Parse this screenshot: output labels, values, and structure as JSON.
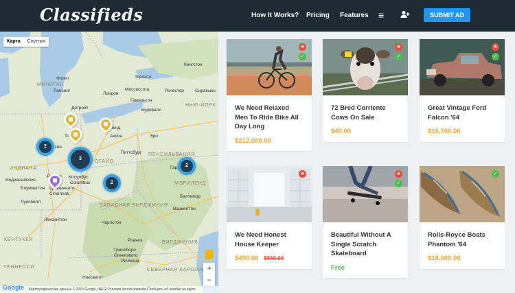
{
  "header": {
    "logo": "Classifieds",
    "nav": [
      "How It Works?",
      "Pricing",
      "Features"
    ],
    "menu_icon": "hamburger-icon",
    "user_icon": "add-user-icon",
    "submit_label": "SUBMIT AD",
    "colors": {
      "bar": "#1e2b33",
      "accent": "#2196f3"
    }
  },
  "map": {
    "type_tabs": [
      "Карта",
      "Спутник"
    ],
    "active_tab": "Карта",
    "regions": [
      "МИЧИГАН",
      "ИНДИАНА",
      "ОГАЙО",
      "ПЕНСИЛЬВАНИЯ",
      "ЗАПАДНАЯ ВИРДЖИНИЯ",
      "ВИРДЖИНИЯ",
      "МЭРИЛЕНД",
      "НЬЮ-ЙОРК",
      "СЕВЕРНАЯ КАРОЛИНА",
      "ТЕННЕССИ",
      "КЕНТУККИ"
    ],
    "cities": [
      "Торонто",
      "Детройт",
      "Толедо",
      "Кливленд",
      "Columbus",
      "Колумбус",
      "Питтсбург",
      "Цинциннати",
      "Cincinnati",
      "Индианаполис",
      "Лексингтон",
      "Ричмонд",
      "Буффало",
      "Рочестер",
      "Вашингтон",
      "Балтимор",
      "Гаррисберг",
      "Эри",
      "Дейтон",
      "Луисвилл",
      "Блумингтон",
      "Кингстон",
      "Сиракьюс",
      "Лансинг",
      "Флинт",
      "Форт-Уэйн",
      "Акрон",
      "Чарлстон",
      "Роанок",
      "Лондон",
      "Гамильтон",
      "Миссиссога",
      "Ноксвилл",
      "Greensboro",
      "Гринсборо"
    ],
    "clusters": [
      {
        "count": "2"
      },
      {
        "count": "3"
      },
      {
        "count": "2"
      },
      {
        "count": "2"
      }
    ],
    "pins": [
      "yellow",
      "yellow",
      "yellow",
      "purple"
    ],
    "footer": "Картографические данные © 2015 Google, INEGI   Условия использования   Сообщить об ошибке на карте",
    "google_logo": "Google",
    "zoom_in": "+",
    "zoom_out": "−"
  },
  "listings": [
    {
      "title": "We Need Relaxed Men To Ride Bike All Day Long",
      "price": "$212,000.00",
      "old_price": "",
      "badges": [
        "star",
        "check"
      ],
      "image": "cyclist"
    },
    {
      "title": "72 Bred Corriente Cows On Sale",
      "price": "$40.00",
      "old_price": "",
      "badges": [
        "star",
        "check"
      ],
      "image": "cow"
    },
    {
      "title": "Great Vintage Ford Falcon '64",
      "price": "$16,700.00",
      "old_price": "",
      "badges": [
        "star",
        "check"
      ],
      "image": "old-truck"
    },
    {
      "title": "We Need Honest House Keeper",
      "price": "$490.00",
      "old_price": "$550.00",
      "badges": [
        "star"
      ],
      "image": "empty-room"
    },
    {
      "title": "Beautiful Without A Single Scratch Skateboard",
      "price": "Free",
      "old_price": "",
      "badges": [
        "star",
        "check"
      ],
      "image": "skateboard"
    },
    {
      "title": "Rolls-Royce Boats Phantom '64",
      "price": "$18,000.00",
      "old_price": "",
      "badges": [
        "check"
      ],
      "image": "boats"
    }
  ]
}
